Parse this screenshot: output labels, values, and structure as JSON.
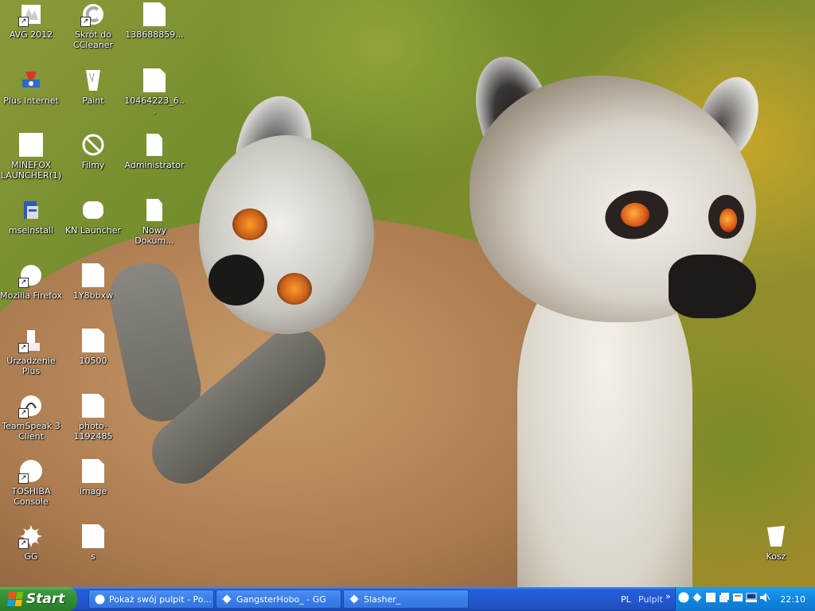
{
  "desktop": {
    "icons": [
      {
        "label": "AVG 2012",
        "icon": "avg-icon",
        "shortcut": true
      },
      {
        "label": "Skrót do CCleaner",
        "icon": "ccleaner-icon",
        "shortcut": true
      },
      {
        "label": "138688859...",
        "icon": "document-icon",
        "shortcut": false
      },
      {
        "label": "Plus Internet",
        "icon": "plus-internet-icon",
        "shortcut": false
      },
      {
        "label": "Paint",
        "icon": "paint-icon",
        "shortcut": false
      },
      {
        "label": "10464223_6...",
        "icon": "document-icon",
        "shortcut": false
      },
      {
        "label": "MINEFOX LAUNCHER(1)",
        "icon": "document-icon",
        "shortcut": false
      },
      {
        "label": "Filmy",
        "icon": "no-entry-icon",
        "shortcut": false
      },
      {
        "label": "Administrator",
        "icon": "folder-icon",
        "shortcut": false
      },
      {
        "label": "mseinstall",
        "icon": "installer-icon",
        "shortcut": false
      },
      {
        "label": "KN Launcher",
        "icon": "launcher-icon",
        "shortcut": false
      },
      {
        "label": "Nowy Dokum...",
        "icon": "text-document-icon",
        "shortcut": false
      },
      {
        "label": "Mozilla Firefox",
        "icon": "firefox-icon",
        "shortcut": true
      },
      {
        "label": "1Y8bbxw",
        "icon": "document-icon",
        "shortcut": false
      },
      {
        "label": "Urzadzenie Plus",
        "icon": "device-icon",
        "shortcut": true
      },
      {
        "label": "10500",
        "icon": "document-icon",
        "shortcut": false
      },
      {
        "label": "TeamSpeak 3 Client",
        "icon": "teamspeak-icon",
        "shortcut": true
      },
      {
        "label": "photo-1192485",
        "icon": "document-icon",
        "shortcut": false
      },
      {
        "label": "TOSHIBA Console",
        "icon": "toshiba-icon",
        "shortcut": true
      },
      {
        "label": "image",
        "icon": "document-icon",
        "shortcut": false
      },
      {
        "label": "GG",
        "icon": "gg-icon",
        "shortcut": true
      },
      {
        "label": "s",
        "icon": "document-icon",
        "shortcut": false
      },
      {
        "label": "Kosz",
        "icon": "recycle-bin-icon",
        "shortcut": false
      }
    ]
  },
  "taskbar": {
    "start_label": "Start",
    "tasks": [
      {
        "label": "Pokaż swój pulpit - Po...",
        "icon": "browser-icon"
      },
      {
        "label": "GangsterHobo_ - GG",
        "icon": "gg-icon"
      },
      {
        "label": "Slasher_",
        "icon": "gg-icon"
      }
    ],
    "language": "PL",
    "toolbar_label": "Pulpit",
    "toolbar_chevron": "»",
    "tray_icons": [
      "circle-icon",
      "gg-icon",
      "window-icon",
      "window-icon",
      "printer-icon",
      "network-icon",
      "speaker-icon"
    ],
    "clock": "22:10"
  }
}
